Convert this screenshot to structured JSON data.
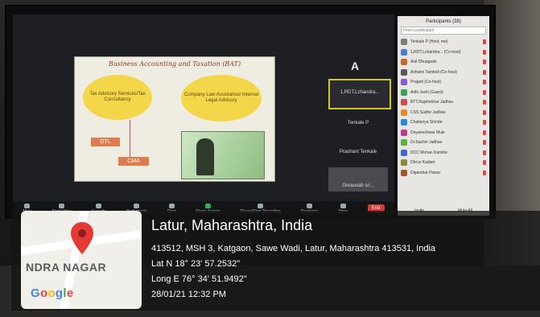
{
  "slide": {
    "title": "Business Accounting and Taxation (BAT)",
    "bubble_left": "Tax Advisory Services/Tax Consultancy",
    "bubble_right": "Company Law Assistance/ Internal Legal Advisory",
    "box1": "DTL",
    "box2": "CMA"
  },
  "video_tiles": [
    {
      "label": "1,RDT,Lchandra..."
    },
    {
      "label": "Tenkale P"
    },
    {
      "label": "Prashant Tenkale"
    },
    {
      "label": "Gorausab sn..."
    }
  ],
  "toolbar": {
    "items": [
      {
        "label": "Mute",
        "icon": "mic-icon"
      },
      {
        "label": "Start Video",
        "icon": "video-icon"
      },
      {
        "label": "Security",
        "icon": "shield-icon"
      },
      {
        "label": "Participants",
        "icon": "people-icon"
      },
      {
        "label": "Chat",
        "icon": "chat-icon"
      },
      {
        "label": "Share Screen",
        "icon": "share-icon"
      },
      {
        "label": "Pause/Stop Recording",
        "icon": "record-icon"
      },
      {
        "label": "Reactions",
        "icon": "reaction-icon"
      },
      {
        "label": "More",
        "icon": "more-icon"
      }
    ],
    "end_label": "End"
  },
  "participants_panel": {
    "title": "Participants (38)",
    "search_placeholder": "Find a participant",
    "foot_left": "Invite",
    "foot_right": "Mute All",
    "rows": [
      {
        "name": "Tenkale P (Host, me)",
        "color": "#7a7a7a"
      },
      {
        "name": "1,RDT,Lchandra... (Co-host)",
        "color": "#4b7bd6"
      },
      {
        "name": "Anil Dhupgude",
        "color": "#c46b2a"
      },
      {
        "name": "Ashwini Tamboli (Co-host)",
        "color": "#5a5a5a"
      },
      {
        "name": "Pragati (Co-host)",
        "color": "#8a5ad0"
      },
      {
        "name": "Aditi Joshi (Guest)",
        "color": "#3aa05a"
      },
      {
        "name": "BTT,Rajshekhar Jadhav",
        "color": "#d04a4a"
      },
      {
        "name": "CSS Sudhir Jadhav",
        "color": "#e08a2a"
      },
      {
        "name": "Chaitanya Shinde",
        "color": "#2a8ad0"
      },
      {
        "name": "Dnyaneshwar Mule",
        "color": "#c43a8a"
      },
      {
        "name": "Dr.Sachin Jadhav",
        "color": "#5ab03a"
      },
      {
        "name": "DCC Mohan Kamble",
        "color": "#3a6ad0"
      },
      {
        "name": "Dhruv Kadam",
        "color": "#8a8a3a"
      },
      {
        "name": "Digambar Pawar",
        "color": "#a05a2a"
      }
    ]
  },
  "geotag": {
    "map_place": "NDRA NAGAR",
    "map_brand": "Google",
    "title": "Latur, Maharashtra, India",
    "address": "413512, MSH 3, Katgaon, Sawe Wadi, Latur, Maharashtra 413531, India",
    "lat": "Lat N 18° 23' 57.2532\"",
    "long": "Long E 76° 34' 51.9492\"",
    "datetime": "28/01/21 12:32 PM"
  }
}
